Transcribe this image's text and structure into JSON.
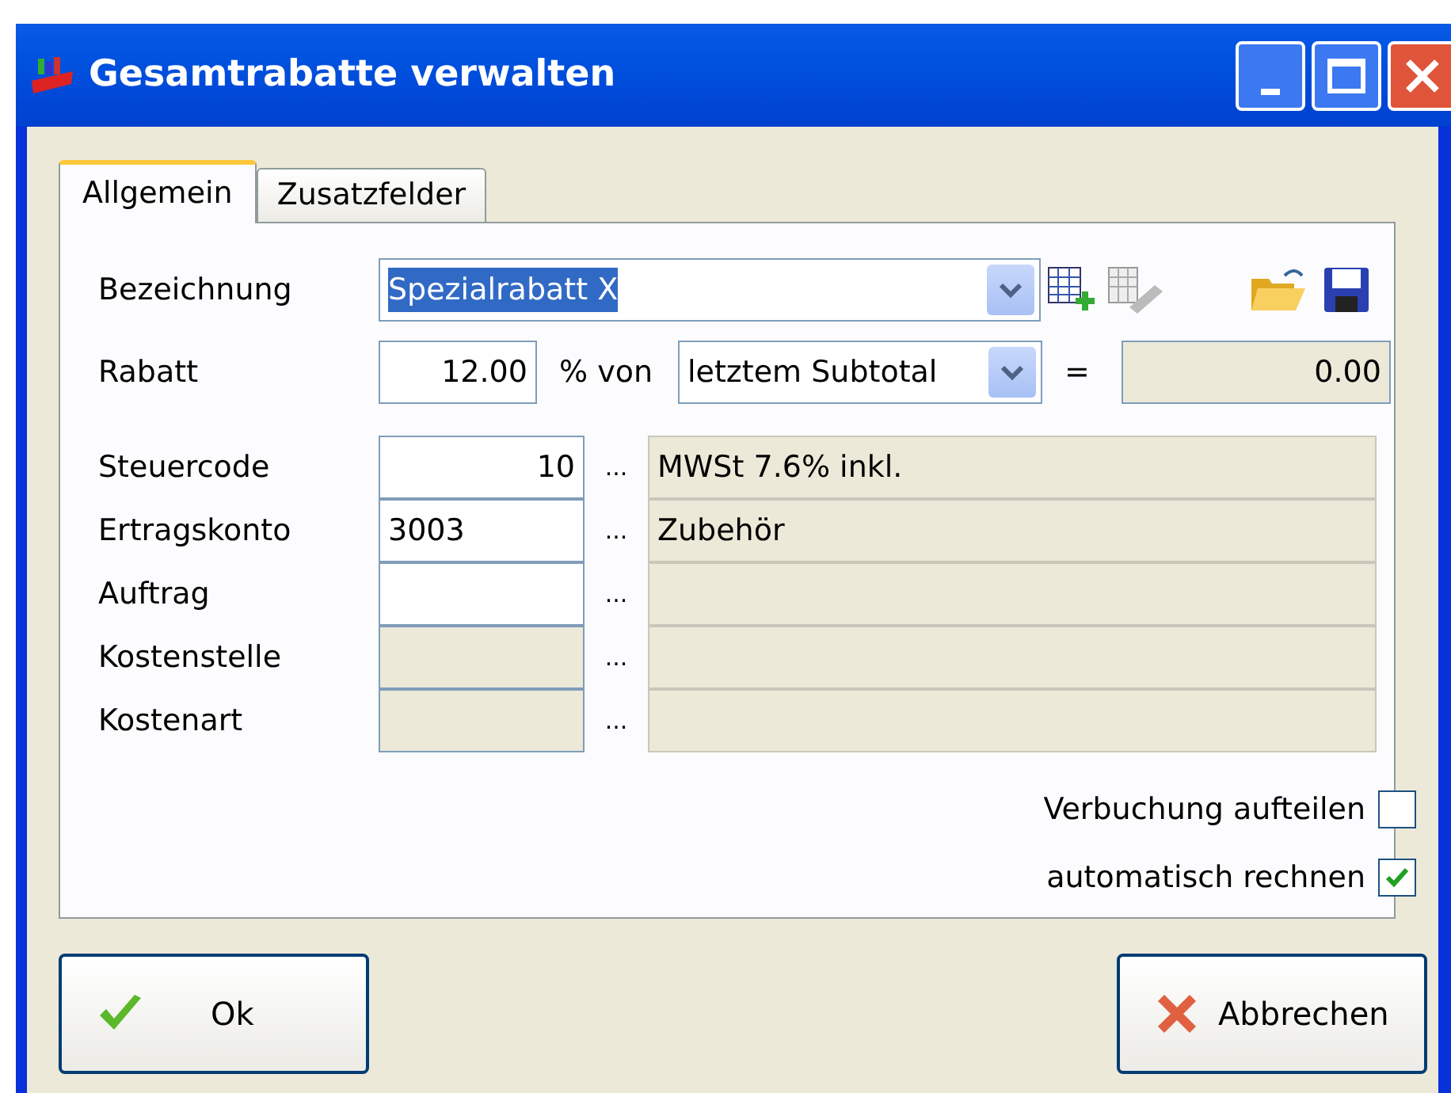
{
  "window": {
    "title": "Gesamtrabatte verwalten"
  },
  "tabs": [
    {
      "label": "Allgemein",
      "selected": true
    },
    {
      "label": "Zusatzfelder",
      "selected": false
    }
  ],
  "bezeichnung": {
    "label": "Bezeichnung",
    "value": "Spezialrabatt X",
    "text_selected": true
  },
  "rabatt": {
    "label": "Rabatt",
    "value": "12.00",
    "unit": "% von",
    "basis": "letztem Subtotal",
    "equals": "=",
    "result": "0.00"
  },
  "accounts": [
    {
      "label": "Steuercode",
      "value": "10",
      "disabled": false,
      "browse": "...",
      "description": "MWSt 7.6% inkl."
    },
    {
      "label": "Ertragskonto",
      "value": "3003",
      "disabled": false,
      "browse": "...",
      "description": "Zubehör"
    },
    {
      "label": "Auftrag",
      "disabled": false,
      "browse": "..."
    },
    {
      "label": "Kostenstelle",
      "disabled": true,
      "browse": "..."
    },
    {
      "label": "Kostenart",
      "disabled": true,
      "browse": "..."
    }
  ],
  "options": [
    {
      "label": "Verbuchung aufteilen",
      "checked": false
    },
    {
      "label": "automatisch rechnen",
      "checked": true
    }
  ],
  "buttons": [
    {
      "kind": "ok",
      "label": "Ok"
    },
    {
      "kind": "cancel",
      "label": "Abbrechen"
    }
  ]
}
